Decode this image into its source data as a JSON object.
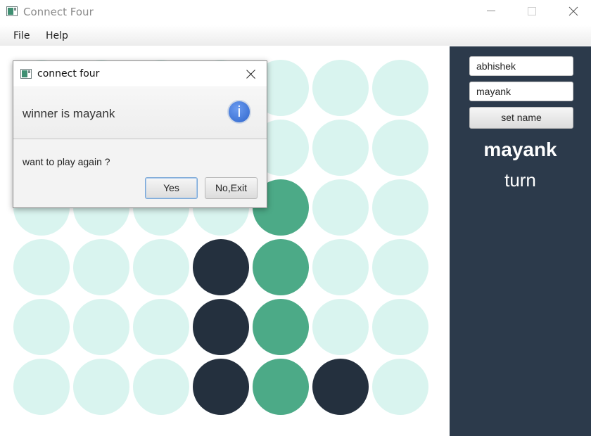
{
  "window": {
    "title": "Connect Four",
    "controls": [
      "minimize-icon",
      "maximize-icon",
      "close-icon"
    ]
  },
  "menu": {
    "items": [
      {
        "label": "File"
      },
      {
        "label": "Help"
      }
    ]
  },
  "board": {
    "rows": 6,
    "cols": 7,
    "colors": {
      "empty": "#d9f4ef",
      "p1": "#24303e",
      "p2": "#4caa87"
    },
    "cells": [
      [
        "empty",
        "empty",
        "empty",
        "empty",
        "empty",
        "empty",
        "empty"
      ],
      [
        "empty",
        "empty",
        "empty",
        "empty",
        "empty",
        "empty",
        "empty"
      ],
      [
        "empty",
        "empty",
        "empty",
        "empty",
        "p2",
        "empty",
        "empty"
      ],
      [
        "empty",
        "empty",
        "empty",
        "p1",
        "p2",
        "empty",
        "empty"
      ],
      [
        "empty",
        "empty",
        "empty",
        "p1",
        "p2",
        "empty",
        "empty"
      ],
      [
        "empty",
        "empty",
        "empty",
        "p1",
        "p2",
        "p1",
        "empty"
      ]
    ]
  },
  "side_panel": {
    "background": "#2c3a4b",
    "player1_name": "abhishek",
    "player2_name": "mayank",
    "set_name_button": "set name",
    "current_player": "mayank",
    "turn_label": "turn"
  },
  "dialog": {
    "title": "connect four",
    "header_text": "winner is mayank",
    "info_icon": "info-icon",
    "info_glyph": "i",
    "content_text": "want to play again ?",
    "buttons": {
      "yes": "Yes",
      "no_exit": "No,Exit"
    }
  }
}
